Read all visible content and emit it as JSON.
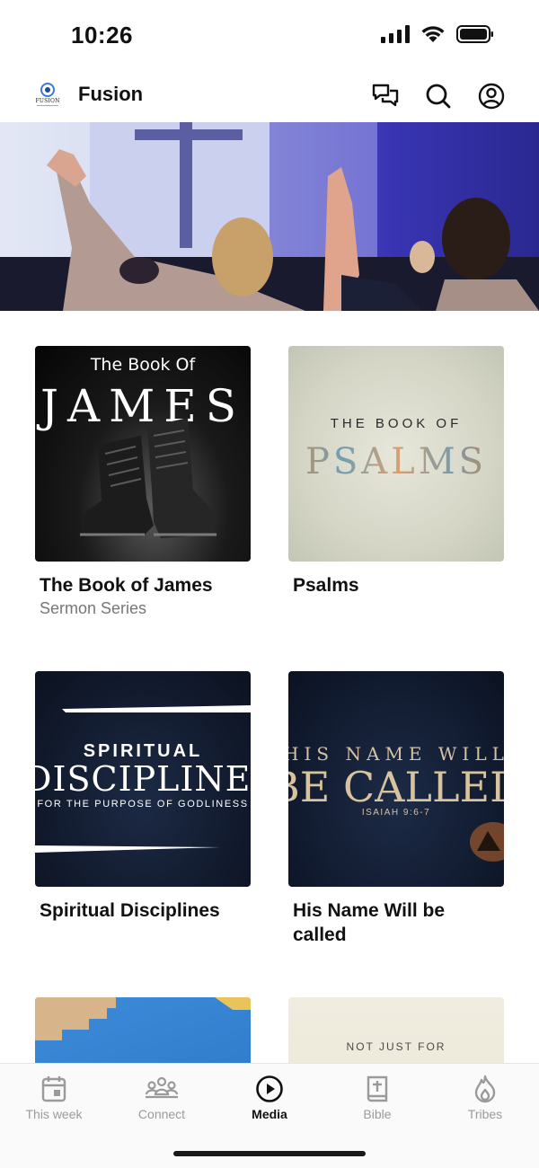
{
  "status_bar": {
    "time": "10:26",
    "icons": [
      "cellular-signal-icon",
      "wifi-icon",
      "battery-icon"
    ]
  },
  "header": {
    "logo_text": "FUSION",
    "app_title": "Fusion",
    "actions": [
      "chat-icon",
      "search-icon",
      "profile-icon"
    ]
  },
  "media": {
    "items": [
      {
        "title": "The Book of James",
        "subtitle": "Sermon Series",
        "art": {
          "line1": "The Book Of",
          "line2": "JAMES"
        }
      },
      {
        "title": "Psalms",
        "subtitle": "",
        "art": {
          "line1": "THE BOOK OF",
          "line2": "PSALMS"
        }
      },
      {
        "title": "Spiritual Disciplines",
        "subtitle": "",
        "art": {
          "line1": "SPIRITUAL",
          "line2": "DISCIPLINES",
          "line3": "FOR THE PURPOSE OF GODLINESS"
        }
      },
      {
        "title": "His Name Will be called",
        "subtitle": "",
        "art": {
          "line1": "HIS NAME WILL",
          "line2": "BE CALLED",
          "line3": "ISAIAH 9:6-7"
        }
      },
      {
        "title": "",
        "subtitle": "",
        "art": {}
      },
      {
        "title": "",
        "subtitle": "",
        "art": {
          "line1": "NOT JUST FOR"
        }
      }
    ]
  },
  "tabs": [
    {
      "label": "This week",
      "icon": "calendar-icon",
      "active": false
    },
    {
      "label": "Connect",
      "icon": "group-icon",
      "active": false
    },
    {
      "label": "Media",
      "icon": "play-circle-icon",
      "active": true
    },
    {
      "label": "Bible",
      "icon": "bible-icon",
      "active": false
    },
    {
      "label": "Tribes",
      "icon": "flame-icon",
      "active": false
    }
  ],
  "colors": {
    "accent": "#111111",
    "inactive_tab": "#9a9a9a",
    "subtitle": "#777777"
  }
}
